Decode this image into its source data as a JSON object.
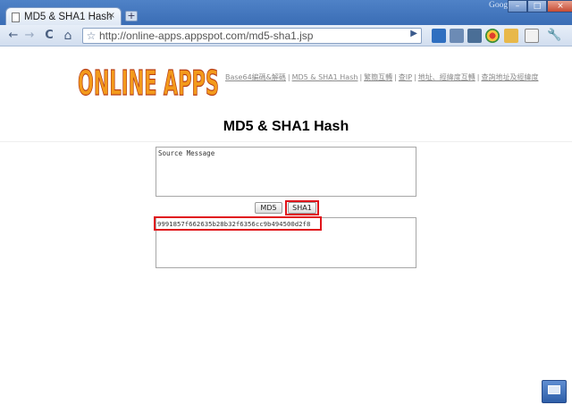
{
  "browser": {
    "tab_title": "MD5 & SHA1 Hash",
    "tab_close": "×",
    "new_tab": "+",
    "top_right_label": "Google",
    "url": "http://online-apps.appspot.com/md5-sha1.jsp",
    "win_minimize": "–",
    "win_maximize": "□",
    "win_close": "×"
  },
  "nav": {
    "back": "←",
    "forward": "→",
    "reload": "C",
    "home": "⌂",
    "star": "☆",
    "go": "▶"
  },
  "site": {
    "logo_text": "ONLINE APPS",
    "links": [
      {
        "label": "Base64編碼&解碼"
      },
      {
        "label": "MD5 & SHA1 Hash"
      },
      {
        "label": "繁簡互轉"
      },
      {
        "label": "查IP"
      },
      {
        "label": "地址、經緯度互轉"
      },
      {
        "label": "查詢地址及經緯度"
      }
    ],
    "separator": "|"
  },
  "main": {
    "title": "MD5 & SHA1 Hash",
    "source_value": "Source Message",
    "md5_label": "MD5",
    "sha1_label": "SHA1",
    "hash_result": "9991857f662635b28b32f6356cc9b494500d2f8"
  },
  "colors": {
    "highlight": "#e0141a",
    "logo_fill": "#f39a1b",
    "logo_outline": "#b8401a"
  }
}
